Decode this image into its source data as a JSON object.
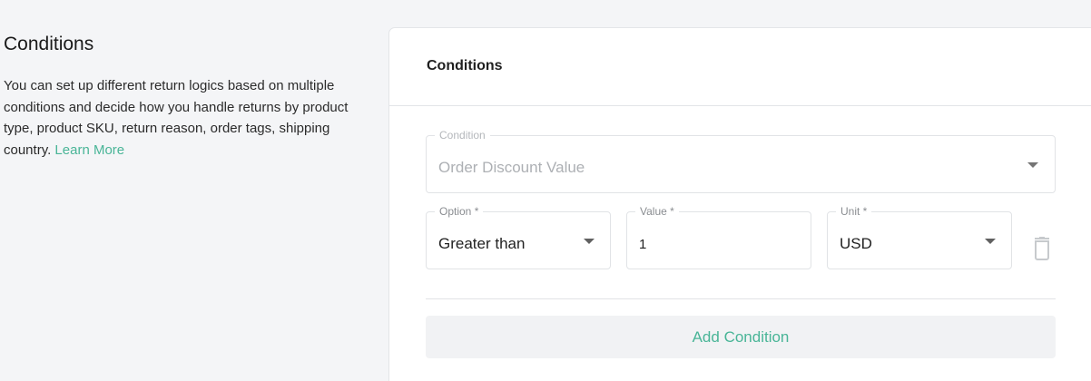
{
  "intro": {
    "title": "Conditions",
    "text": "You can set up different return logics based on multiple conditions and decide how you handle returns by product type, product SKU, return reason, order tags, shipping country.",
    "link": "Learn More"
  },
  "card": {
    "title": "Conditions",
    "condition": {
      "label": "Condition",
      "value": "Order Discount Value"
    },
    "option": {
      "label": "Option *",
      "value": "Greater than"
    },
    "value_field": {
      "label": "Value *",
      "value": "1"
    },
    "unit": {
      "label": "Unit *",
      "value": "USD"
    },
    "add_button": "Add Condition"
  },
  "colors": {
    "accent": "#49b597",
    "background": "#f4f5f7",
    "border": "#e1e3e6"
  },
  "icons": [
    "chevron-down-icon",
    "trash-icon"
  ]
}
